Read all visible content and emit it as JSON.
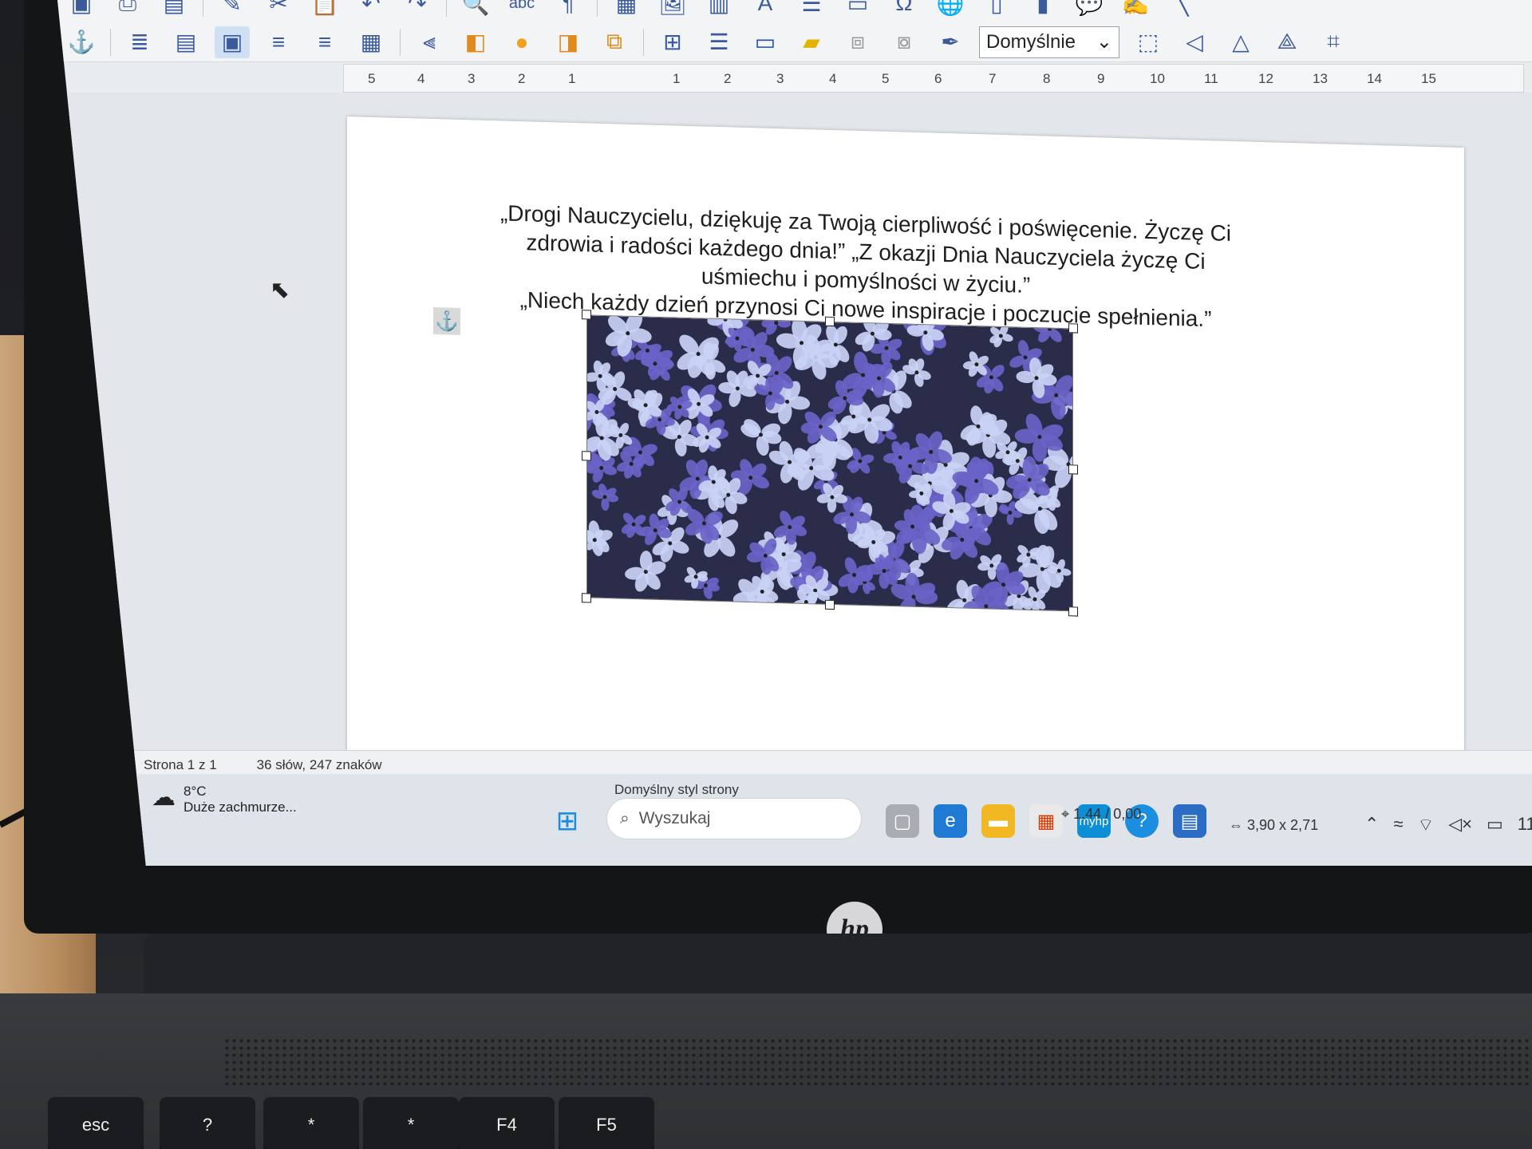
{
  "toolbar": {
    "style_value": "Domyślnie",
    "row1_icons": [
      "save-icon",
      "print-icon",
      "print-preview-icon",
      "clone-icon",
      "cut-icon",
      "paste-icon",
      "undo-icon",
      "redo-icon",
      "find-replace-icon",
      "spellcheck-icon",
      "formatting-marks-icon",
      "table-icon",
      "image-icon",
      "chart-icon",
      "textbox-icon",
      "page-break-icon",
      "field-icon",
      "special-character-icon",
      "hyperlink-icon",
      "footnote-icon",
      "endnote-icon",
      "bookmark-icon",
      "cross-reference-icon",
      "comment-icon",
      "track-changes-icon",
      "line-icon"
    ],
    "row2_icons": [
      "anchor-icon",
      "wrap-off-icon",
      "wrap-page-icon",
      "wrap-optimal-icon",
      "wrap-left-icon",
      "wrap-right-icon",
      "wrap-through-icon",
      "align-icon",
      "bring-forward-icon",
      "circle-shape-icon",
      "send-back-icon",
      "arrange-icon",
      "borders-icon",
      "line-style-icon",
      "border-color-icon",
      "area-fill-icon",
      "group-icon",
      "ungroup-icon",
      "highlighter-icon"
    ],
    "row2_right_icons": [
      "frame-properties-icon",
      "rotate-left-icon",
      "flip-vertical-icon",
      "flip-horizontal-icon",
      "crop-icon",
      "transparency-icon"
    ]
  },
  "ruler": {
    "left_labels": [
      "5",
      "4",
      "3",
      "2",
      "1"
    ],
    "right_labels": [
      "1",
      "2",
      "3",
      "4",
      "5",
      "6",
      "7",
      "8",
      "9",
      "10",
      "11",
      "12",
      "13",
      "14",
      "15"
    ]
  },
  "document": {
    "line1": "„Drogi Nauczycielu, dziękuję za Twoją cierpliwość i poświęcenie. Życzę Ci",
    "line2": "zdrowia i radości każdego dnia!” „Z okazji Dnia Nauczyciela życzę Ci",
    "line3": "uśmiechu i pomyślności w życiu.”",
    "line4": "„Niech każdy dzień przynosi Ci nowe inspiracje i poczucie spełnienia.”"
  },
  "statusbar": {
    "page": "Strona 1 z 1",
    "words": "36 słów, 247 znaków",
    "page_style": "Domyślny styl strony",
    "position": "1,44 / 0,00",
    "size": "3,90 x 2,71"
  },
  "taskbar": {
    "temperature": "8°C",
    "weather": "Duże zachmurze...",
    "search_placeholder": "Wyszukaj",
    "clock": "11"
  },
  "laptop": {
    "brand": "hp",
    "keys": [
      "esc",
      "?",
      "*",
      "*",
      "F4",
      "F5"
    ]
  },
  "colors": {
    "accent": "#3a5a9a",
    "selection": "#cfe0f5",
    "flower_light": "#c9d2f5",
    "flower_dark": "#6a63c7"
  }
}
